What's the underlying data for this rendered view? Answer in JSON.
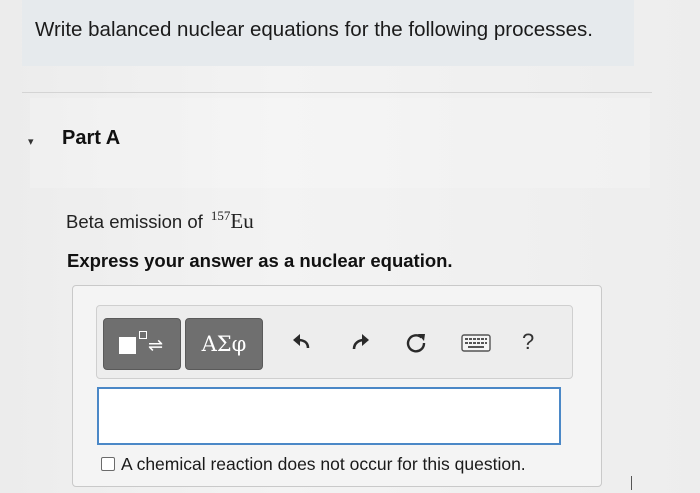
{
  "header": {
    "title": "Write balanced nuclear equations for the following processes."
  },
  "part": {
    "marker": "▾",
    "title": "Part A"
  },
  "problem": {
    "prefix": "Beta emission of",
    "isotope_mass": "157",
    "isotope_symbol": "Eu"
  },
  "instruction": "Express your answer as a nuclear equation.",
  "toolbar": {
    "greek_label": "ΑΣφ",
    "help_label": "?",
    "icons": [
      "templates-icon",
      "greek-symbols-icon",
      "undo-icon",
      "redo-icon",
      "reset-icon",
      "keyboard-icon",
      "help-icon"
    ]
  },
  "answer": {
    "value": ""
  },
  "no_reaction": {
    "label": "A chemical reaction does not occur for this question.",
    "checked": false
  },
  "colors": {
    "input_border": "#4b88c7",
    "toolbar_button": "#6f6f6f",
    "header_bg": "#e6eaed"
  }
}
